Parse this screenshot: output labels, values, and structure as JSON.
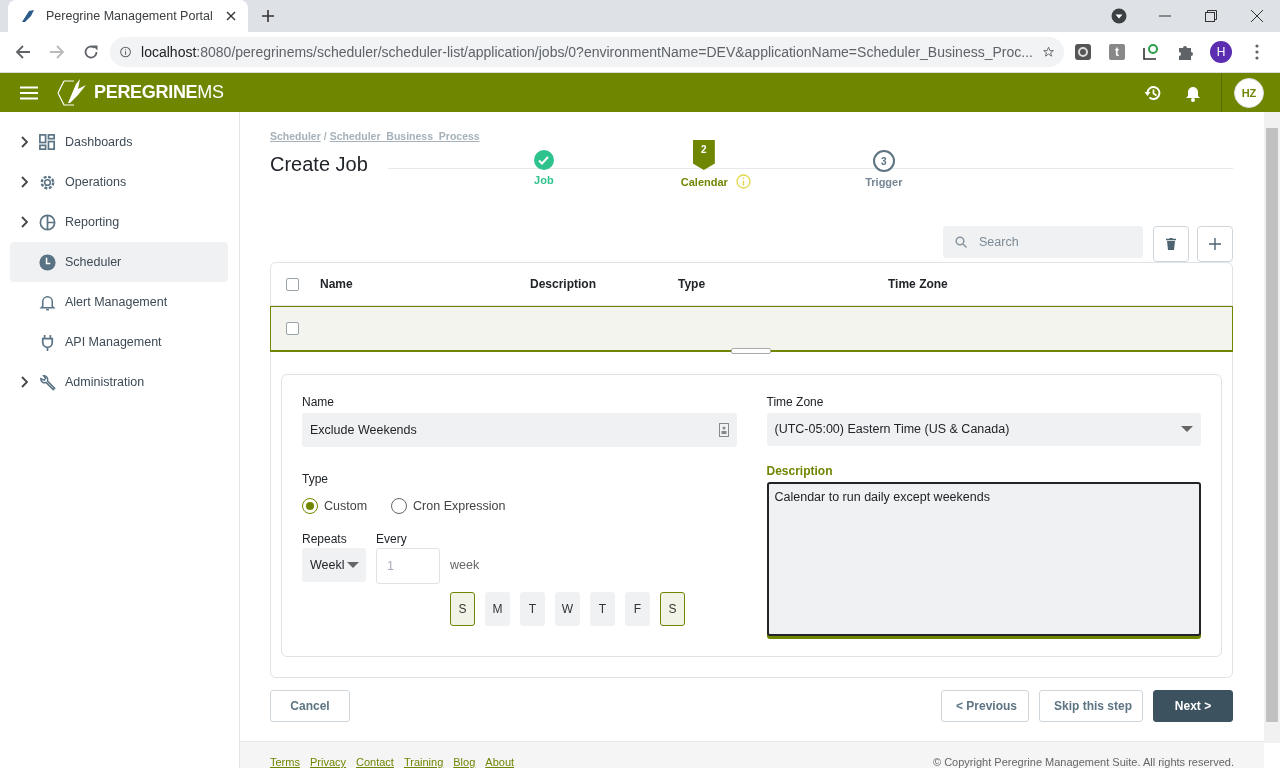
{
  "browser": {
    "tab_title": "Peregrine Management Portal",
    "url_host": "localhost",
    "url_rest": ":8080/peregrinems/scheduler/scheduler-list/application/jobs/0?environmentName=DEV&applicationName=Scheduler_Business_Proc...",
    "extension_letter": "t",
    "profile_initial": "H"
  },
  "header": {
    "logo": "**PEREGRINE**MS",
    "avatar": "HZ"
  },
  "sidebar": {
    "items": [
      {
        "label": "Dashboards",
        "kind": "grid",
        "expandable": true,
        "selected": false
      },
      {
        "label": "Operations",
        "kind": "gear",
        "expandable": true,
        "selected": false
      },
      {
        "label": "Reporting",
        "kind": "pie",
        "expandable": true,
        "selected": false
      },
      {
        "label": "Scheduler",
        "kind": "clock",
        "expandable": false,
        "selected": true
      },
      {
        "label": "Alert Management",
        "kind": "bell",
        "expandable": false,
        "selected": false
      },
      {
        "label": "API Management",
        "kind": "plug",
        "expandable": false,
        "selected": false
      },
      {
        "label": "Administration",
        "kind": "wrench",
        "expandable": true,
        "selected": false
      }
    ]
  },
  "breadcrumb": {
    "items": [
      "Scheduler",
      "Scheduler_Business_Process"
    ],
    "separator": "/"
  },
  "title": "Create Job",
  "steps": [
    {
      "label": "Job",
      "kind": "done"
    },
    {
      "number": "2",
      "label": "Calendar",
      "kind": "current",
      "info": true
    },
    {
      "number": "3",
      "label": "Trigger",
      "kind": "pending"
    }
  ],
  "search": {
    "placeholder": "Search"
  },
  "table": {
    "header_checked": false,
    "columns": [
      "Name",
      "Description",
      "Type",
      "Time Zone"
    ],
    "rows": [
      {
        "checked": false,
        "selected": true
      }
    ]
  },
  "form": {
    "name_label": "Name",
    "name_value": "Exclude Weekends",
    "timezone_label": "Time Zone",
    "timezone_value": "(UTC-05:00) Eastern Time (US & Canada)",
    "type_label": "Type",
    "type_options": [
      {
        "label": "Custom",
        "selected": true
      },
      {
        "label": "Cron Expression",
        "selected": false
      }
    ],
    "repeats_label": "Repeats",
    "repeats_value": "Weekl",
    "every_label": "Every",
    "every_value": "1",
    "every_unit": "week",
    "days": [
      {
        "label": "S",
        "selected": true
      },
      {
        "label": "M",
        "selected": false
      },
      {
        "label": "T",
        "selected": false
      },
      {
        "label": "W",
        "selected": false
      },
      {
        "label": "T",
        "selected": false
      },
      {
        "label": "F",
        "selected": false
      },
      {
        "label": "S",
        "selected": true
      }
    ],
    "description_label": "Description",
    "description_value": "Calendar to run daily except weekends"
  },
  "buttons": {
    "cancel": "Cancel",
    "previous": "< Previous",
    "skip": "Skip this step",
    "next": "Next >"
  },
  "footer": {
    "links": [
      "Terms",
      "Privacy",
      "Contact",
      "Training",
      "Blog",
      "About"
    ],
    "copyright": "© Copyright Peregrine Management Suite. All rights reserved."
  }
}
